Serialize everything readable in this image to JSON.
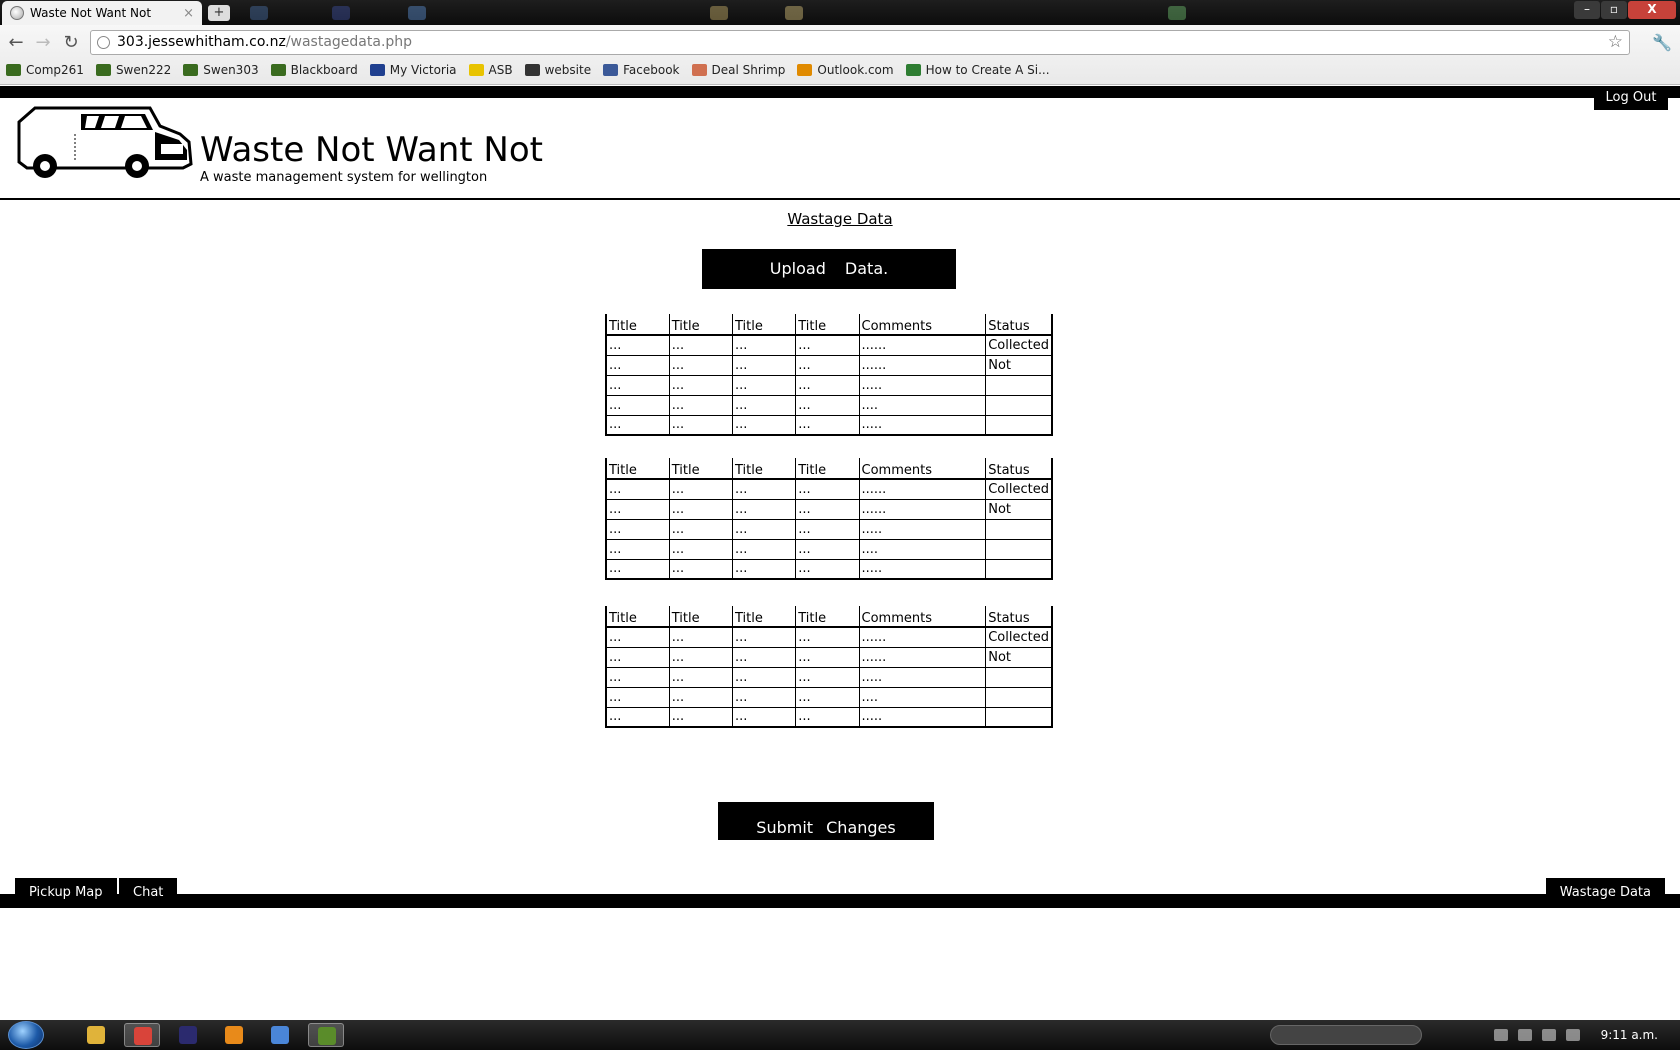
{
  "browser": {
    "tab_title": "Waste Not Want Not",
    "tab_close": "×",
    "new_tab": "+",
    "url_host": "303.jessewhitham.co.nz",
    "url_path": "/wastagedata.php",
    "back": "←",
    "forward": "→",
    "reload": "↻",
    "star": "☆",
    "wrench": "🔧",
    "window": {
      "minimize": "–",
      "maximize": "▫",
      "close": "X"
    },
    "bookmarks": [
      {
        "label": "Comp261",
        "color": "#3a6b1f"
      },
      {
        "label": "Swen222",
        "color": "#3a6b1f"
      },
      {
        "label": "Swen303",
        "color": "#3a6b1f"
      },
      {
        "label": "Blackboard",
        "color": "#3a6b1f"
      },
      {
        "label": "My Victoria",
        "color": "#1f3f8f"
      },
      {
        "label": "ASB",
        "color": "#e8c300"
      },
      {
        "label": "website",
        "color": "#333333"
      },
      {
        "label": "Facebook",
        "color": "#3b5998"
      },
      {
        "label": "Deal Shrimp",
        "color": "#d07050"
      },
      {
        "label": "Outlook.com",
        "color": "#e08a00"
      },
      {
        "label": "How to Create A Si...",
        "color": "#2e7d32"
      }
    ]
  },
  "site": {
    "logout": "Log Out",
    "title": "Waste Not Want Not",
    "subtitle": "A waste management system for wellington",
    "page_heading": "Wastage Data",
    "upload_button": "Upload Data.",
    "submit_button": "Submit Changes",
    "footer": {
      "pickup_map": "Pickup Map",
      "chat": "Chat",
      "wastage_data": "Wastage Data"
    }
  },
  "tables": [
    {
      "headers": [
        "Title",
        "Title",
        "Title",
        "Title",
        "Comments",
        "Status"
      ],
      "rows": [
        [
          "...",
          "...",
          "...",
          "...",
          "......",
          "Collected"
        ],
        [
          "...",
          "...",
          "...",
          "...",
          "......",
          "Not"
        ],
        [
          "...",
          "...",
          "...",
          "...",
          ".....",
          ""
        ],
        [
          "...",
          "...",
          "...",
          "...",
          "....",
          ""
        ],
        [
          "...",
          "...",
          "...",
          "...",
          ".....",
          ""
        ]
      ]
    },
    {
      "headers": [
        "Title",
        "Title",
        "Title",
        "Title",
        "Comments",
        "Status"
      ],
      "rows": [
        [
          "...",
          "...",
          "...",
          "...",
          "......",
          "Collected"
        ],
        [
          "...",
          "...",
          "...",
          "...",
          "......",
          "Not"
        ],
        [
          "...",
          "...",
          "...",
          "...",
          ".....",
          ""
        ],
        [
          "...",
          "...",
          "...",
          "...",
          "....",
          ""
        ],
        [
          "...",
          "...",
          "...",
          "...",
          ".....",
          ""
        ]
      ]
    },
    {
      "headers": [
        "Title",
        "Title",
        "Title",
        "Title",
        "Comments",
        "Status"
      ],
      "rows": [
        [
          "...",
          "...",
          "...",
          "...",
          "......",
          "Collected"
        ],
        [
          "...",
          "...",
          "...",
          "...",
          "......",
          "Not"
        ],
        [
          "...",
          "...",
          "...",
          "...",
          ".....",
          ""
        ],
        [
          "...",
          "...",
          "...",
          "...",
          "....",
          ""
        ],
        [
          "...",
          "...",
          "...",
          "...",
          ".....",
          ""
        ]
      ]
    }
  ],
  "taskbar": {
    "clock": "9:11 a.m.",
    "apps": [
      {
        "name": "explorer",
        "color": "#e0b33a",
        "active": false
      },
      {
        "name": "chrome",
        "color": "#d9443a",
        "active": true
      },
      {
        "name": "eclipse",
        "color": "#2b2a6e",
        "active": false
      },
      {
        "name": "media-player",
        "color": "#e88a1a",
        "active": false
      },
      {
        "name": "itunes",
        "color": "#4a86d8",
        "active": false
      },
      {
        "name": "dreamweaver",
        "color": "#5a8c2a",
        "active": true
      }
    ]
  }
}
